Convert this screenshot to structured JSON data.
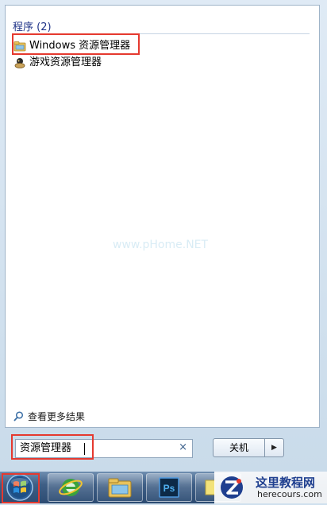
{
  "results": {
    "section_header": "程序 (2)",
    "items": [
      {
        "label": "Windows 资源管理器",
        "icon": "folder-explorer-icon"
      },
      {
        "label": "游戏资源管理器",
        "icon": "game-explorer-icon"
      }
    ],
    "watermark": "www.pHome.NET",
    "see_more": "查看更多结果"
  },
  "search": {
    "value": "资源管理器",
    "clear": "×"
  },
  "shutdown": {
    "label": "关机",
    "arrow": "▶"
  },
  "taskbar": {
    "buttons": [
      "ie-icon",
      "explorer-icon",
      "photoshop-icon",
      "app-icon"
    ],
    "ps_label": "Ps"
  },
  "logo": {
    "name": "这里教程网",
    "url": "herecours.com"
  },
  "colors": {
    "highlight": "#e5392f",
    "header_text": "#1e3287",
    "taskbar": "#3f5f86"
  }
}
